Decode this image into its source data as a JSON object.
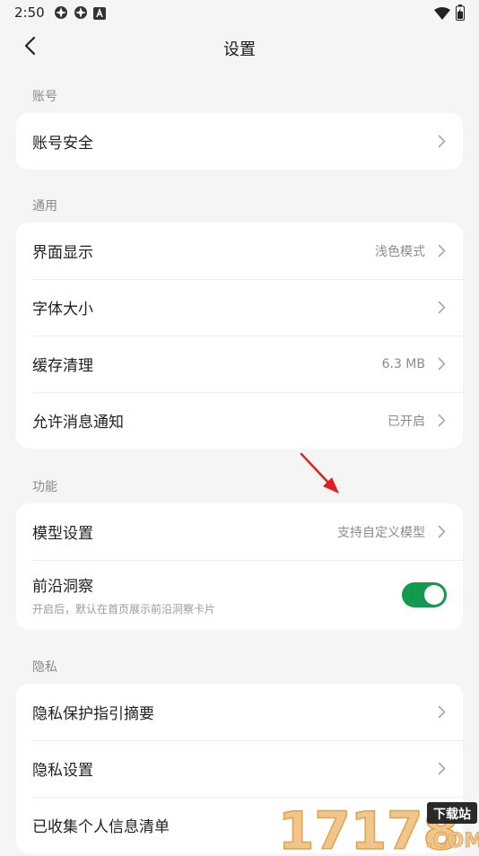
{
  "status_bar": {
    "time": "2:50",
    "left_icons": [
      "app-notification-icon",
      "app-notification-icon",
      "a-icon"
    ],
    "right_icons": [
      "wifi-icon",
      "battery-icon"
    ]
  },
  "nav": {
    "title": "设置",
    "back_icon": "chevron-left-icon"
  },
  "sections": {
    "account": {
      "header": "账号",
      "items": [
        {
          "label": "账号安全"
        }
      ]
    },
    "general": {
      "header": "通用",
      "items": [
        {
          "label": "界面显示",
          "value": "浅色模式"
        },
        {
          "label": "字体大小"
        },
        {
          "label": "缓存清理",
          "value": "6.3 MB"
        },
        {
          "label": "允许消息通知",
          "value": "已开启"
        }
      ]
    },
    "features": {
      "header": "功能",
      "items": [
        {
          "label": "模型设置",
          "value": "支持自定义模型"
        },
        {
          "label": "前沿洞察",
          "desc": "开启后，默认在首页展示前沿洞察卡片",
          "toggle_on": true
        }
      ]
    },
    "privacy": {
      "header": "隐私",
      "items": [
        {
          "label": "隐私保护指引摘要"
        },
        {
          "label": "隐私设置"
        },
        {
          "label": "已收集个人信息清单"
        }
      ]
    }
  },
  "colors": {
    "accent_green": "#129a4e",
    "annotation_red": "#e02020"
  },
  "watermark": {
    "number_text": "17178",
    "site_text": ".COM",
    "badge_text": "下载站"
  }
}
